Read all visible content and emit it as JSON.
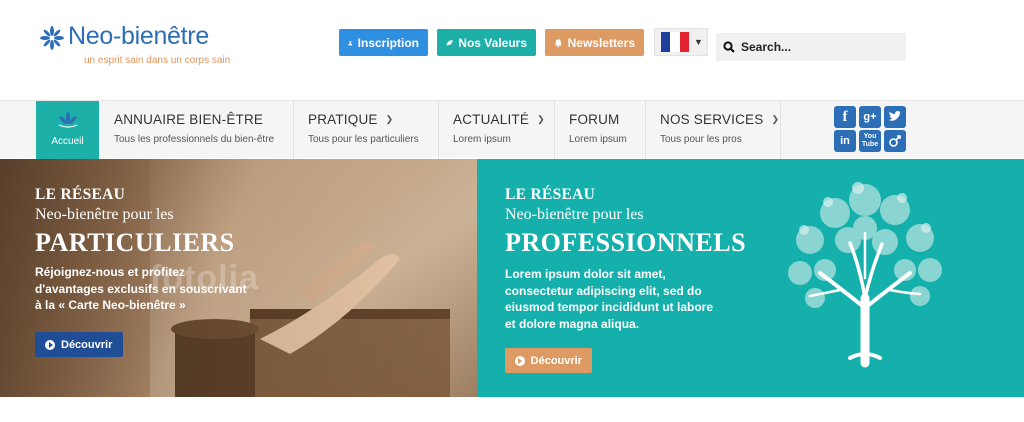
{
  "header": {
    "logo_name": "Neo-bienêtre",
    "logo_tagline": "un esprit sain dans un corps sain",
    "buttons": {
      "inscription": "Inscription",
      "valeurs": "Nos Valeurs",
      "newsletters": "Newsletters"
    },
    "language": "FR",
    "search_placeholder": "Search..."
  },
  "nav": {
    "home_label": "Accueil",
    "items": [
      {
        "title": "ANNUAIRE BIEN-ÊTRE",
        "subtitle": "Tous les professionnels du bien-être",
        "has_dropdown": false
      },
      {
        "title": "PRATIQUE",
        "subtitle": "Tous pour les particuliers",
        "has_dropdown": true
      },
      {
        "title": "ACTUALITÉ",
        "subtitle": "Lorem ipsum",
        "has_dropdown": true
      },
      {
        "title": "FORUM",
        "subtitle": "Lorem ipsum",
        "has_dropdown": false
      },
      {
        "title": "NOS SERVICES",
        "subtitle": "Tous pour les pros",
        "has_dropdown": true
      }
    ],
    "social": [
      "facebook",
      "google-plus",
      "twitter",
      "linkedin",
      "youtube",
      "myspace"
    ]
  },
  "banners": {
    "left": {
      "eyebrow": "LE RÉSEAU",
      "line2": "Neo-bienêtre pour les",
      "headline": "PARTICULIERS",
      "text": [
        "Réjoignez-nous et profitez",
        "d'avantages exclusifs en souscrivant",
        "à la « Carte Neo-bienêtre »"
      ],
      "cta": "Découvrir",
      "watermark": "fotolia"
    },
    "right": {
      "eyebrow": "LE RÉSEAU",
      "line2": "Neo-bienêtre pour les",
      "headline": "PROFESSIONNELS",
      "text": [
        "Lorem ipsum dolor sit amet,",
        "consectetur adipiscing elit, sed do",
        "eiusmod tempor incididunt ut labore",
        "et dolore magna aliqua."
      ],
      "cta": "Découvrir"
    }
  },
  "colors": {
    "brand_blue": "#2c6fb7",
    "teal": "#15b0ab",
    "orange": "#de9a63",
    "inscription_blue": "#2f8fe0",
    "navy": "#1f4e96"
  }
}
